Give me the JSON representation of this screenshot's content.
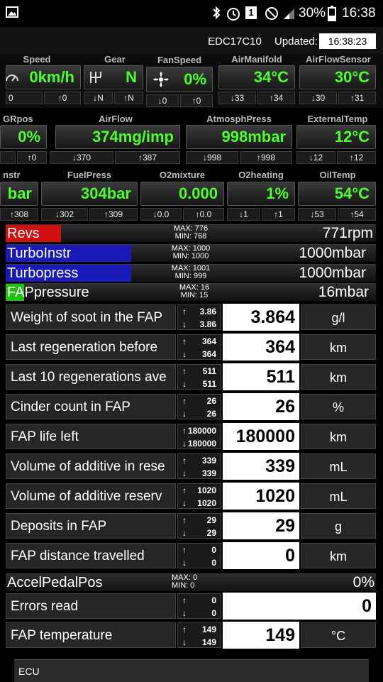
{
  "status": {
    "battery": "30%",
    "time": "16:38",
    "sim": "1"
  },
  "header": {
    "ecu": "EDC17C10",
    "updated_label": "Updated:",
    "updated_time": "16:38:23"
  },
  "gauges": {
    "row1": [
      {
        "label": "Speed",
        "value": "0km/h",
        "sub": [
          "0",
          "↑0"
        ]
      },
      {
        "label": "Gear",
        "value": "N",
        "sub": [
          "↓N",
          "↑N"
        ]
      },
      {
        "label": "FanSpeed",
        "value": "0%",
        "sub": [
          "↓0",
          "↑0"
        ]
      },
      {
        "label": "AirManifold",
        "value": "34°C",
        "sub": [
          "↓33",
          "↑34"
        ]
      },
      {
        "label": "AirFlowSensor",
        "value": "30°C",
        "sub": [
          "↓30",
          "↑31"
        ]
      }
    ],
    "row2": [
      {
        "label": "GRpos",
        "value": "0%",
        "sub": [
          "",
          "↑0"
        ]
      },
      {
        "label": "AirFlow",
        "value": "374mg/imp",
        "sub": [
          "↓370",
          "↑387"
        ]
      },
      {
        "label": "AtmosphPress",
        "value": "998mbar",
        "sub": [
          "↓998",
          "↑998"
        ]
      },
      {
        "label": "ExternalTemp",
        "value": "12°C",
        "sub": [
          "↓12",
          "↑12"
        ]
      }
    ],
    "row3": [
      {
        "label": "nstr",
        "value": "bar",
        "sub": [
          "↑308"
        ]
      },
      {
        "label": "FuelPress",
        "value": "304bar",
        "sub": [
          "↓302",
          "↑309"
        ]
      },
      {
        "label": "O2mixture",
        "value": "0.000",
        "sub": [
          "↓0.0",
          "↑0.0"
        ]
      },
      {
        "label": "O2heating",
        "value": "1%",
        "sub": [
          "↓1",
          "↑1"
        ]
      },
      {
        "label": "OilTemp",
        "value": "54°C",
        "sub": [
          "↓53",
          "↑54"
        ]
      }
    ]
  },
  "bars": [
    {
      "name": "Revs",
      "max": "MAX: 776",
      "min": "MIN: 768",
      "value": "771rpm",
      "color": "#d01010",
      "level": 0.15
    },
    {
      "name": "TurboInstr",
      "max": "MAX: 1000",
      "min": "MIN: 1000",
      "value": "1000mbar",
      "color": "#1a1ab8",
      "level": 0.34
    },
    {
      "name": "Turbopress",
      "max": "MAX: 1001",
      "min": "MIN: 999",
      "value": "1000mbar",
      "color": "#1a1ab8",
      "level": 0.34
    },
    {
      "name": "FAPpressure",
      "max": "MAX: 16",
      "min": "MIN: 15",
      "value": "16mbar",
      "color": "#22c012",
      "level": 0.05
    }
  ],
  "params": [
    {
      "name": "Weight of soot in the FAP",
      "up": "3.86",
      "down": "3.86",
      "value": "3.864",
      "unit": "g/l"
    },
    {
      "name": "Last regeneration before",
      "up": "364",
      "down": "364",
      "value": "364",
      "unit": "km"
    },
    {
      "name": "Last 10 regenerations ave",
      "up": "511",
      "down": "511",
      "value": "511",
      "unit": "km"
    },
    {
      "name": "Cinder count in FAP",
      "up": "26",
      "down": "26",
      "value": "26",
      "unit": "%"
    },
    {
      "name": "FAP life left",
      "up": "180000",
      "down": "180000",
      "value": "180000",
      "unit": "km"
    },
    {
      "name": "Volume of additive in rese",
      "up": "339",
      "down": "339",
      "value": "339",
      "unit": "mL"
    },
    {
      "name": "Volume of additive reserv",
      "up": "1020",
      "down": "1020",
      "value": "1020",
      "unit": "mL"
    },
    {
      "name": "Deposits in FAP",
      "up": "29",
      "down": "29",
      "value": "29",
      "unit": "g"
    },
    {
      "name": "FAP distance travelled",
      "up": "0",
      "down": "0",
      "value": "0",
      "unit": "km"
    }
  ],
  "accel": {
    "name": "AccelPedalPos",
    "max": "MAX: 0",
    "min": "MIN: 0",
    "value": "0%"
  },
  "errors": {
    "name": "Errors read",
    "up": "0",
    "down": "0",
    "value": "0"
  },
  "faptemp": {
    "name": "FAP temperature",
    "up": "149",
    "down": "149",
    "value": "149",
    "unit": "°C"
  },
  "footer": {
    "label": "ECU"
  }
}
